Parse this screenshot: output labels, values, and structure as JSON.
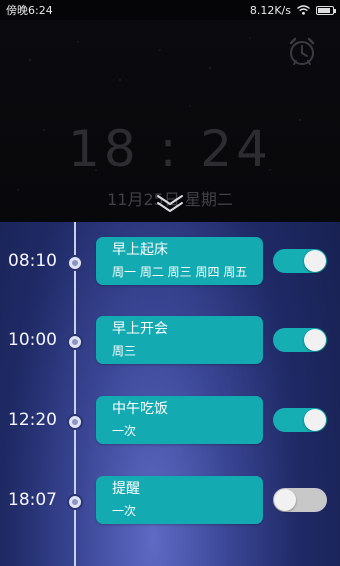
{
  "status_bar": {
    "time": "傍晚6:24",
    "network_speed": "8.12K/s",
    "icons": [
      "wifi-icon",
      "battery-icon"
    ],
    "battery_level": 0.85
  },
  "clock": {
    "time": "18 : 24",
    "date": "11月25日 星期二",
    "alarm_icon": "alarm-clock-icon",
    "collapse_icon": "chevron-down-icon"
  },
  "colors": {
    "card": "#13aab1",
    "toggle_on": "#14aeb3",
    "toggle_off": "#c8c8c8",
    "timeline": "#c9d0ea"
  },
  "alarms": [
    {
      "time": "08:10",
      "title": "早上起床",
      "repeat": "周一 周二 周三 周四 周五",
      "enabled": true
    },
    {
      "time": "10:00",
      "title": "早上开会",
      "repeat": "周三",
      "enabled": true
    },
    {
      "time": "12:20",
      "title": "中午吃饭",
      "repeat": "一次",
      "enabled": true
    },
    {
      "time": "18:07",
      "title": "提醒",
      "repeat": "一次",
      "enabled": false
    }
  ]
}
